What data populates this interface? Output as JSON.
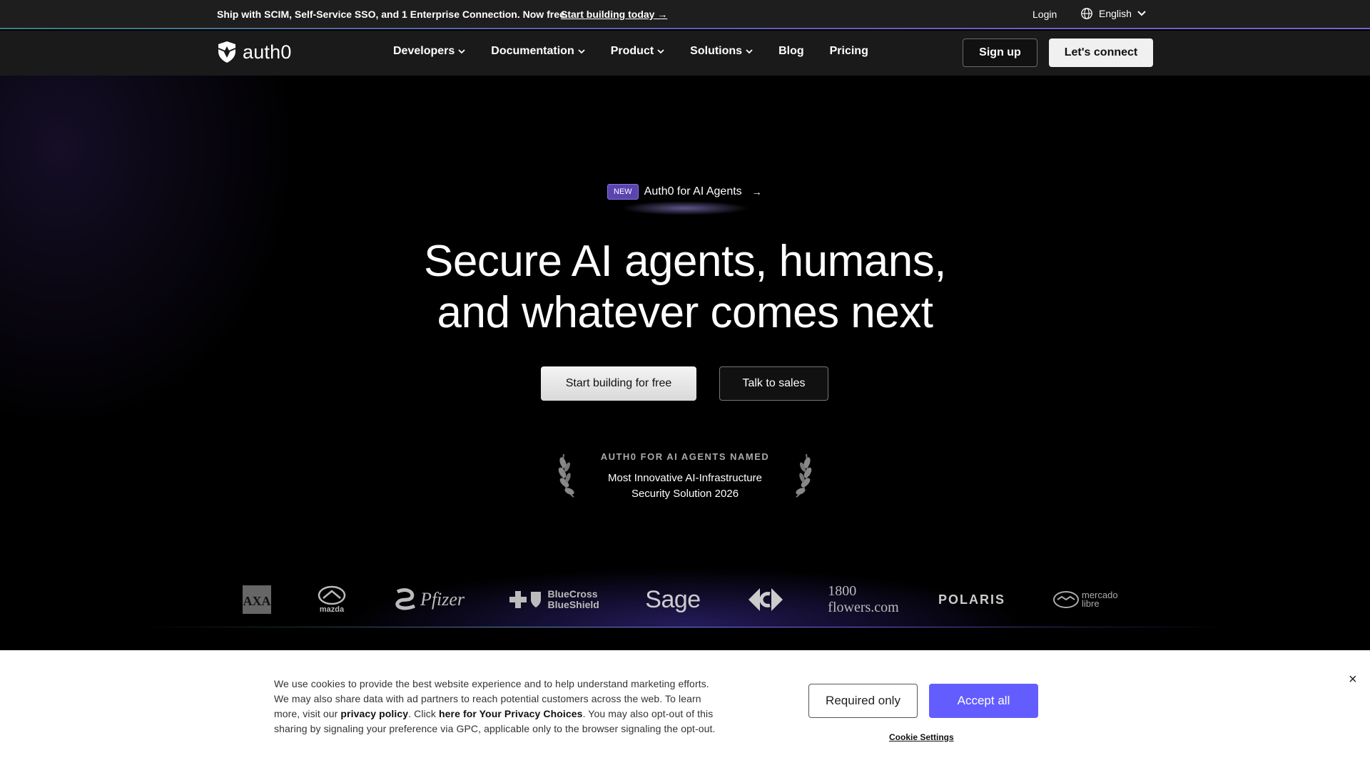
{
  "announcement": {
    "text": "Ship with SCIM, Self-Service SSO, and 1 Enterprise Connection. Now free.",
    "link": "Start building today →",
    "login": "Login",
    "language": "English"
  },
  "nav": {
    "brand": "auth0",
    "items": [
      {
        "label": "Developers",
        "dropdown": true
      },
      {
        "label": "Documentation",
        "dropdown": true
      },
      {
        "label": "Product",
        "dropdown": true
      },
      {
        "label": "Solutions",
        "dropdown": true
      },
      {
        "label": "Blog",
        "dropdown": false
      },
      {
        "label": "Pricing",
        "dropdown": false
      }
    ],
    "signup": "Sign up",
    "connect": "Let's connect"
  },
  "hero": {
    "badge": "NEW",
    "pill_text": "Auth0 for AI Agents",
    "pill_arrow": "→",
    "headline_line1": "Secure AI agents, humans,",
    "headline_line2": "and whatever comes next",
    "cta_primary": "Start building for free",
    "cta_secondary": "Talk to sales",
    "award_kicker": "AUTH0 FOR AI AGENTS NAMED",
    "award_title": "Most Innovative AI-Infrastructure Security Solution 2026"
  },
  "customers": {
    "logos": [
      "AXA",
      "mazda",
      "Pfizer",
      "BlueCross BlueShield",
      "Sage",
      "Carrefour",
      "1800 flowers.com",
      "POLARIS",
      "mercado libre"
    ]
  },
  "cookie": {
    "text_1": "We use cookies to provide the best website experience and to help understand marketing efforts. We may also share data with ad partners to reach potential customers across the web. To learn more, visit our ",
    "privacy_link": "privacy policy",
    "text_2": ". Click ",
    "choices_link": "here for Your Privacy Choices",
    "text_3": ". You may also opt-out of this sharing by signaling your preference via GPC, applicable only to the browser signaling the opt-out.",
    "required_only": "Required only",
    "accept_all": "Accept all",
    "settings": "Cookie Settings",
    "close": "×"
  },
  "colors": {
    "accent": "#635dff",
    "badge": "#5b44b0",
    "background": "#000000"
  }
}
